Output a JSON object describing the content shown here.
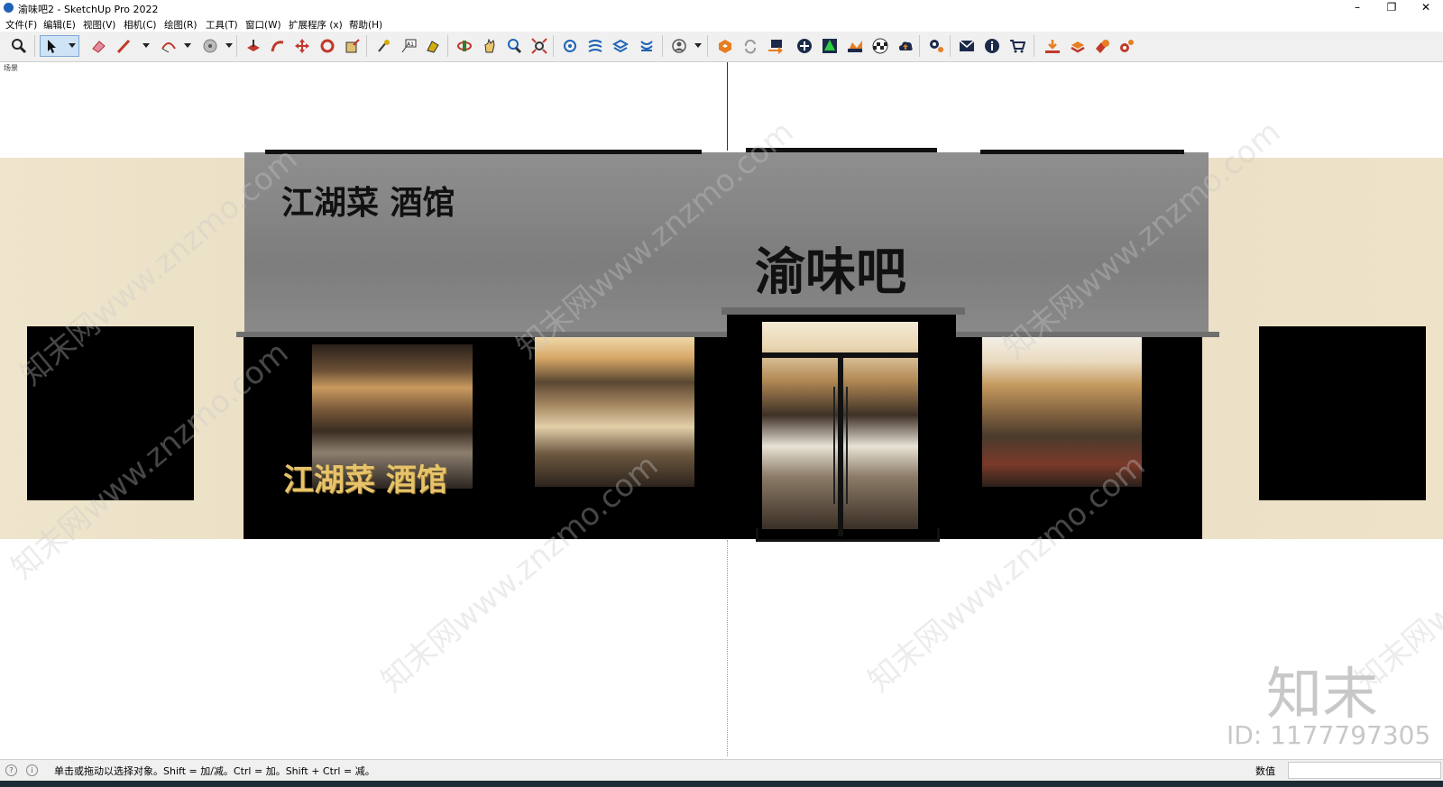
{
  "window": {
    "title": "渝味吧2 - SketchUp Pro 2022",
    "minimize": "–",
    "restore": "❐",
    "close": "✕"
  },
  "menu": [
    {
      "label": "文件(F)"
    },
    {
      "label": "编辑(E)"
    },
    {
      "label": "视图(V)"
    },
    {
      "label": "相机(C)"
    },
    {
      "label": "绘图(R)"
    },
    {
      "label": "工具(T)"
    },
    {
      "label": "窗口(W)"
    },
    {
      "label": "扩展程序 (x)"
    },
    {
      "label": "帮助(H)"
    }
  ],
  "toolbar": {
    "icons": [
      "zoom-icon",
      "select-icon",
      "eraser-icon",
      "pencil-icon",
      "arc-icon",
      "paint-bucket-icon",
      "push-pull-icon",
      "follow-me-icon",
      "move-icon",
      "rotate-icon",
      "scale-icon",
      "tape-measure-icon",
      "text-icon",
      "paint-icon",
      "orbit-icon",
      "pan-icon",
      "zoom-window-icon",
      "zoom-extents-icon",
      "components-icon",
      "styles-icon",
      "layers-icon",
      "scenes-icon",
      "user-icon",
      "extension-warehouse-icon",
      "refresh-icon",
      "import-icon",
      "add-icon",
      "tree-icon",
      "terrain-icon",
      "checker-icon",
      "cloud-upload-icon",
      "settings-icon",
      "mail-icon",
      "info-icon",
      "cart-icon",
      "download-icon",
      "layers-plus-icon",
      "dynamic-components-icon",
      "gear-icon"
    ]
  },
  "viewport": {
    "scene_tab": "场景"
  },
  "facade": {
    "sign_left_top": "江湖菜 酒馆",
    "sign_main": "渝味吧",
    "sign_window": "江湖菜 酒馆",
    "colors": {
      "wall": "#e9dec3",
      "awning": "#858585",
      "frame": "#000000",
      "sign_gold": "#e7c46b"
    }
  },
  "watermark": {
    "text": "知末网www.znzmo.com",
    "brand": "知末",
    "id": "ID: 1177797305"
  },
  "status": {
    "hint": "单击或拖动以选择对象。Shift = 加/减。Ctrl = 加。Shift + Ctrl = 减。",
    "value_label": "数值",
    "value": ""
  }
}
